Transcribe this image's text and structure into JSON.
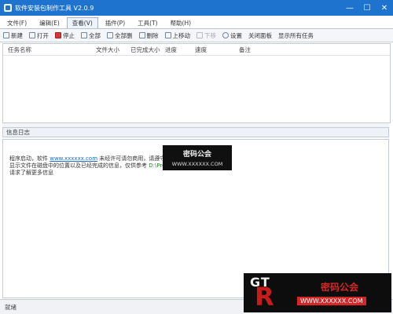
{
  "window": {
    "title": "软件安装包制作工具 V2.0.9",
    "min": "—",
    "max": "☐",
    "close": "✕"
  },
  "menu": {
    "tabs": [
      {
        "label": "文件(F)"
      },
      {
        "label": "编辑(E)"
      },
      {
        "label": "查看(V)"
      },
      {
        "label": "插件(P)"
      },
      {
        "label": "工具(T)"
      },
      {
        "label": "帮助(H)"
      }
    ]
  },
  "toolbar": {
    "items": [
      {
        "label": "新建",
        "icon": "new-icon"
      },
      {
        "label": "打开",
        "icon": "open-icon"
      },
      {
        "label": "停止",
        "icon": "stop-icon"
      },
      {
        "label": "全部",
        "icon": "select-all-icon"
      },
      {
        "label": "全部删",
        "icon": "delete-all-icon"
      },
      {
        "label": "删除",
        "icon": "delete-icon"
      },
      {
        "label": "上移动",
        "icon": "move-up-icon"
      },
      {
        "label": "下移",
        "icon": "move-down-icon"
      },
      {
        "label": "设置",
        "icon": "settings-icon"
      },
      {
        "label": "关闭面板",
        "icon": "close-panel-icon"
      },
      {
        "label": "显示所有任务",
        "icon": "show-all-icon"
      }
    ]
  },
  "list": {
    "columns": [
      "任务名称",
      "文件大小",
      "已完成大小",
      "进度",
      "速度",
      "备注"
    ]
  },
  "log": {
    "label": "信息日志",
    "lines": [
      {
        "text": "程序启动，软件",
        "link": "www.xxxxxx.com",
        "tail": "未经许可请勿商用，请遵守相关规定"
      },
      {
        "text": "显示文件在磁盘中的位置以及已经完成的信息，仅供参考",
        "path": "D:\\Program Files\\Setup"
      },
      {
        "text": "请求了解更多信息"
      }
    ]
  },
  "status": {
    "text": "就绪"
  },
  "watermark": {
    "center_line1": "密码公会",
    "center_line2": "WWW.XXXXXX.COM",
    "corner_logo": "GT",
    "corner_r": "R",
    "corner_line1": "密码公会",
    "corner_line2": "WWW.XXXXXX.COM"
  }
}
